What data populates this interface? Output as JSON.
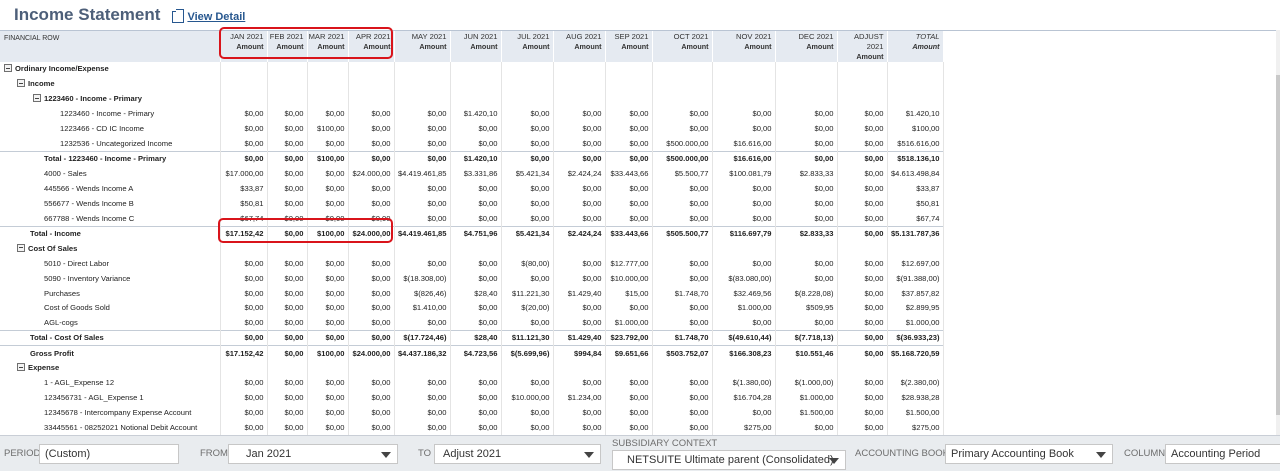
{
  "header": {
    "title": "Income Statement",
    "view_detail": "View Detail"
  },
  "table": {
    "first_col_label": "FINANCIAL ROW",
    "amount_label": "Amount",
    "columns": [
      "JAN 2021",
      "FEB 2021",
      "MAR 2021",
      "APR 2021",
      "MAY 2021",
      "JUN 2021",
      "JUL 2021",
      "AUG 2021",
      "SEP 2021",
      "OCT 2021",
      "NOV 2021",
      "DEC 2021",
      "ADJUST 2021",
      "TOTAL"
    ],
    "rows": [
      {
        "label": "Ordinary Income/Expense",
        "kind": "section",
        "level": 0,
        "values": []
      },
      {
        "label": "Income",
        "kind": "section",
        "level": 1,
        "values": []
      },
      {
        "label": "1223460 - Income - Primary",
        "kind": "section",
        "level": 2,
        "values": []
      },
      {
        "label": "1223460 - Income - Primary",
        "kind": "item",
        "level": 3,
        "values": [
          "$0,00",
          "$0,00",
          "$0,00",
          "$0,00",
          "$0,00",
          "$1.420,10",
          "$0,00",
          "$0,00",
          "$0,00",
          "$0,00",
          "$0,00",
          "$0,00",
          "$0,00",
          "$1.420,10"
        ]
      },
      {
        "label": "1223466 - CD IC Income",
        "kind": "item",
        "level": 3,
        "values": [
          "$0,00",
          "$0,00",
          "$100,00",
          "$0,00",
          "$0,00",
          "$0,00",
          "$0,00",
          "$0,00",
          "$0,00",
          "$0,00",
          "$0,00",
          "$0,00",
          "$0,00",
          "$100,00"
        ]
      },
      {
        "label": "1232536 - Uncategorized Income",
        "kind": "item",
        "level": 3,
        "values": [
          "$0,00",
          "$0,00",
          "$0,00",
          "$0,00",
          "$0,00",
          "$0,00",
          "$0,00",
          "$0,00",
          "$0,00",
          "$500.000,00",
          "$16.616,00",
          "$0,00",
          "$0,00",
          "$516.616,00"
        ]
      },
      {
        "label": "Total - 1223460 - Income - Primary",
        "kind": "total",
        "level": "t2",
        "values": [
          "$0,00",
          "$0,00",
          "$100,00",
          "$0,00",
          "$0,00",
          "$1.420,10",
          "$0,00",
          "$0,00",
          "$0,00",
          "$500.000,00",
          "$16.616,00",
          "$0,00",
          "$0,00",
          "$518.136,10"
        ]
      },
      {
        "label": "4000 - Sales",
        "kind": "item",
        "level": "s",
        "values": [
          "$17.000,00",
          "$0,00",
          "$0,00",
          "$24.000,00",
          "$4.419.461,85",
          "$3.331,86",
          "$5.421,34",
          "$2.424,24",
          "$33.443,66",
          "$5.500,77",
          "$100.081,79",
          "$2.833,33",
          "$0,00",
          "$4.613.498,84"
        ]
      },
      {
        "label": "445566 - Wends Income A",
        "kind": "item",
        "level": "s",
        "values": [
          "$33,87",
          "$0,00",
          "$0,00",
          "$0,00",
          "$0,00",
          "$0,00",
          "$0,00",
          "$0,00",
          "$0,00",
          "$0,00",
          "$0,00",
          "$0,00",
          "$0,00",
          "$33,87"
        ]
      },
      {
        "label": "556677 - Wends Income B",
        "kind": "item",
        "level": "s",
        "values": [
          "$50,81",
          "$0,00",
          "$0,00",
          "$0,00",
          "$0,00",
          "$0,00",
          "$0,00",
          "$0,00",
          "$0,00",
          "$0,00",
          "$0,00",
          "$0,00",
          "$0,00",
          "$50,81"
        ]
      },
      {
        "label": "667788 - Wends Income C",
        "kind": "item",
        "level": "s",
        "values": [
          "$67,74",
          "$0,00",
          "$0,00",
          "$0,00",
          "$0,00",
          "$0,00",
          "$0,00",
          "$0,00",
          "$0,00",
          "$0,00",
          "$0,00",
          "$0,00",
          "$0,00",
          "$67,74"
        ]
      },
      {
        "label": "Total - Income",
        "kind": "total",
        "level": "t1",
        "values": [
          "$17.152,42",
          "$0,00",
          "$100,00",
          "$24.000,00",
          "$4.419.461,85",
          "$4.751,96",
          "$5.421,34",
          "$2.424,24",
          "$33.443,66",
          "$505.500,77",
          "$116.697,79",
          "$2.833,33",
          "$0,00",
          "$5.131.787,36"
        ]
      },
      {
        "label": "Cost Of Sales",
        "kind": "section",
        "level": 1,
        "values": []
      },
      {
        "label": "5010 - Direct Labor",
        "kind": "item",
        "level": "s",
        "values": [
          "$0,00",
          "$0,00",
          "$0,00",
          "$0,00",
          "$0,00",
          "$0,00",
          "$(80,00)",
          "$0,00",
          "$12.777,00",
          "$0,00",
          "$0,00",
          "$0,00",
          "$0,00",
          "$12.697,00"
        ]
      },
      {
        "label": "5090 - Inventory Variance",
        "kind": "item",
        "level": "s",
        "values": [
          "$0,00",
          "$0,00",
          "$0,00",
          "$0,00",
          "$(18.308,00)",
          "$0,00",
          "$0,00",
          "$0,00",
          "$10.000,00",
          "$0,00",
          "$(83.080,00)",
          "$0,00",
          "$0,00",
          "$(91.388,00)"
        ]
      },
      {
        "label": "Purchases",
        "kind": "item",
        "level": "s",
        "values": [
          "$0,00",
          "$0,00",
          "$0,00",
          "$0,00",
          "$(826,46)",
          "$28,40",
          "$11.221,30",
          "$1.429,40",
          "$15,00",
          "$1.748,70",
          "$32.469,56",
          "$(8.228,08)",
          "$0,00",
          "$37.857,82"
        ]
      },
      {
        "label": "Cost of Goods Sold",
        "kind": "item",
        "level": "s",
        "values": [
          "$0,00",
          "$0,00",
          "$0,00",
          "$0,00",
          "$1.410,00",
          "$0,00",
          "$(20,00)",
          "$0,00",
          "$0,00",
          "$0,00",
          "$1.000,00",
          "$509,95",
          "$0,00",
          "$2.899,95"
        ]
      },
      {
        "label": "AGL-cogs",
        "kind": "item",
        "level": "s",
        "values": [
          "$0,00",
          "$0,00",
          "$0,00",
          "$0,00",
          "$0,00",
          "$0,00",
          "$0,00",
          "$0,00",
          "$1.000,00",
          "$0,00",
          "$0,00",
          "$0,00",
          "$0,00",
          "$1.000,00"
        ]
      },
      {
        "label": "Total - Cost Of Sales",
        "kind": "total",
        "level": "t1",
        "values": [
          "$0,00",
          "$0,00",
          "$0,00",
          "$0,00",
          "$(17.724,46)",
          "$28,40",
          "$11.121,30",
          "$1.429,40",
          "$23.792,00",
          "$1.748,70",
          "$(49.610,44)",
          "$(7.718,13)",
          "$0,00",
          "$(36.933,23)"
        ]
      },
      {
        "label": "Gross Profit",
        "kind": "total",
        "level": "t1",
        "values": [
          "$17.152,42",
          "$0,00",
          "$100,00",
          "$24.000,00",
          "$4.437.186,32",
          "$4.723,56",
          "$(5.699,96)",
          "$994,84",
          "$9.651,66",
          "$503.752,07",
          "$166.308,23",
          "$10.551,46",
          "$0,00",
          "$5.168.720,59"
        ]
      },
      {
        "label": "Expense",
        "kind": "section",
        "level": 1,
        "values": []
      },
      {
        "label": "1 - AGL_Expense 12",
        "kind": "item",
        "level": "s",
        "values": [
          "$0,00",
          "$0,00",
          "$0,00",
          "$0,00",
          "$0,00",
          "$0,00",
          "$0,00",
          "$0,00",
          "$0,00",
          "$0,00",
          "$(1.380,00)",
          "$(1.000,00)",
          "$0,00",
          "$(2.380,00)"
        ]
      },
      {
        "label": "123456731 - AGL_Expense 1",
        "kind": "item",
        "level": "s",
        "values": [
          "$0,00",
          "$0,00",
          "$0,00",
          "$0,00",
          "$0,00",
          "$0,00",
          "$10.000,00",
          "$1.234,00",
          "$0,00",
          "$0,00",
          "$16.704,28",
          "$1.000,00",
          "$0,00",
          "$28.938,28"
        ]
      },
      {
        "label": "12345678 - Intercompany Expense Account",
        "kind": "item",
        "level": "s",
        "values": [
          "$0,00",
          "$0,00",
          "$0,00",
          "$0,00",
          "$0,00",
          "$0,00",
          "$0,00",
          "$0,00",
          "$0,00",
          "$0,00",
          "$0,00",
          "$1.500,00",
          "$0,00",
          "$1.500,00"
        ]
      },
      {
        "label": "33445561 - 08252021 Notional Debit Account",
        "kind": "item",
        "level": "s",
        "values": [
          "$0,00",
          "$0,00",
          "$0,00",
          "$0,00",
          "$0,00",
          "$0,00",
          "$0,00",
          "$0,00",
          "$0,00",
          "$0,00",
          "$275,00",
          "$0,00",
          "$0,00",
          "$275,00"
        ]
      }
    ]
  },
  "footer": {
    "period_label": "PERIOD",
    "period_value": "(Custom)",
    "from_label": "FROM",
    "from_value": "Jan 2021",
    "to_label": "TO",
    "to_value": "Adjust 2021",
    "subsidiary_label": "SUBSIDIARY CONTEXT",
    "subsidiary_value": "NETSUITE Ultimate parent (Consolidated)",
    "book_label": "ACCOUNTING BOOK",
    "book_value": "Primary Accounting Book",
    "column_label": "COLUMN",
    "column_value": "Accounting Period"
  },
  "colors": {
    "title": "#4d5f79",
    "header_bg": "#e5eaf1",
    "link": "#27578f",
    "highlight": "#d9141b"
  }
}
